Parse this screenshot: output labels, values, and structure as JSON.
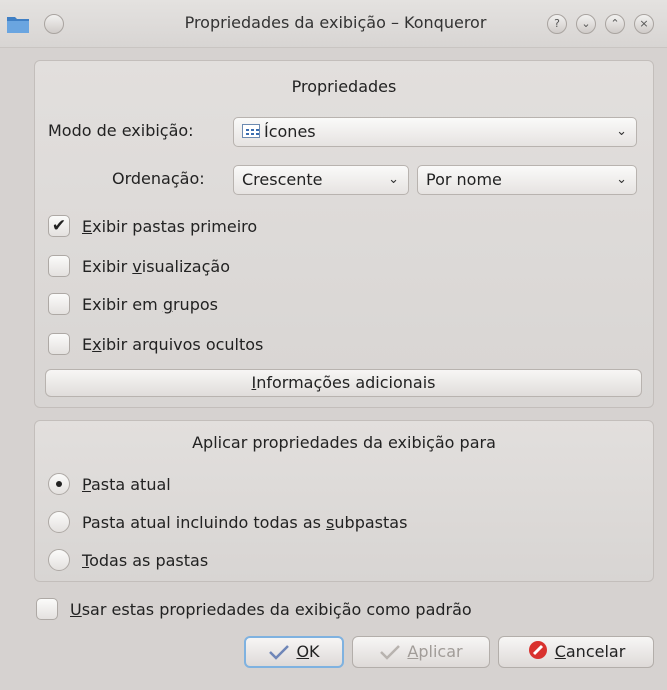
{
  "window": {
    "title": "Propriedades da exibição – Konqueror",
    "buttons": [
      "?",
      "⌄",
      "⌃",
      "×"
    ]
  },
  "properties": {
    "title": "Propriedades",
    "view_mode_label": "Modo de exibição:",
    "view_mode_value": "Ícones",
    "sort_label": "Ordenação:",
    "sort_order_value": "Crescente",
    "sort_by_value": "Por nome",
    "options": [
      {
        "prefix": "",
        "accel": "E",
        "suffix": "xibir pastas primeiro",
        "checked": true
      },
      {
        "prefix": "Exibir ",
        "accel": "v",
        "suffix": "isualização",
        "checked": false
      },
      {
        "prefix": "Exibir em ",
        "accel": "g",
        "suffix": "rupos",
        "checked": false
      },
      {
        "prefix": "E",
        "accel": "x",
        "suffix": "ibir arquivos ocultos",
        "checked": false
      }
    ],
    "additional_button": {
      "accel": "I",
      "rest": "nformações adicionais"
    }
  },
  "apply": {
    "title": "Aplicar propriedades da exibição para",
    "options": [
      {
        "prefix": "",
        "accel": "P",
        "suffix": "asta atual",
        "selected": true
      },
      {
        "prefix": "Pasta atual incluindo todas as ",
        "accel": "s",
        "suffix": "ubpastas",
        "selected": false
      },
      {
        "prefix": "",
        "accel": "T",
        "suffix": "odas as pastas",
        "selected": false
      }
    ]
  },
  "default_checkbox": {
    "accel": "U",
    "rest": "sar estas propriedades da exibição como padrão",
    "checked": false
  },
  "buttons": {
    "ok": {
      "accel": "O",
      "rest": "K"
    },
    "apply": {
      "accel": "A",
      "rest": "plicar"
    },
    "cancel": {
      "accel": "C",
      "rest": "ancelar"
    }
  }
}
